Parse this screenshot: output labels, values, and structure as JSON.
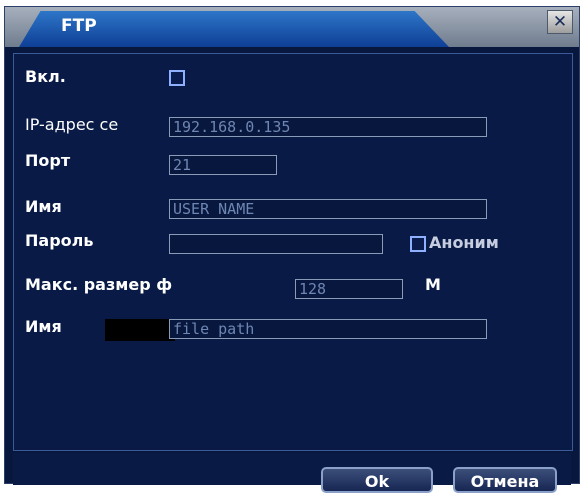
{
  "window": {
    "title": "FTP",
    "close_glyph": "✕"
  },
  "form": {
    "enable_label": "Вкл.",
    "ip_label": "IP-адрес се",
    "ip_value": "192.168.0.135",
    "port_label": "Порт",
    "port_value": "21",
    "name_label": "Имя",
    "name_value": "USER NAME",
    "password_label": "Пароль",
    "password_value": "",
    "anon_label": "Аноним",
    "maxsize_label": "Макс. размер ф",
    "maxsize_value": "128",
    "maxsize_unit": "М",
    "path_label": "Имя",
    "path_value": "file path"
  },
  "buttons": {
    "ok": "Ok",
    "cancel": "Отмена"
  },
  "colors": {
    "background": "#07173d",
    "tab": "#1b5bb5",
    "border": "#8a9bb8"
  }
}
